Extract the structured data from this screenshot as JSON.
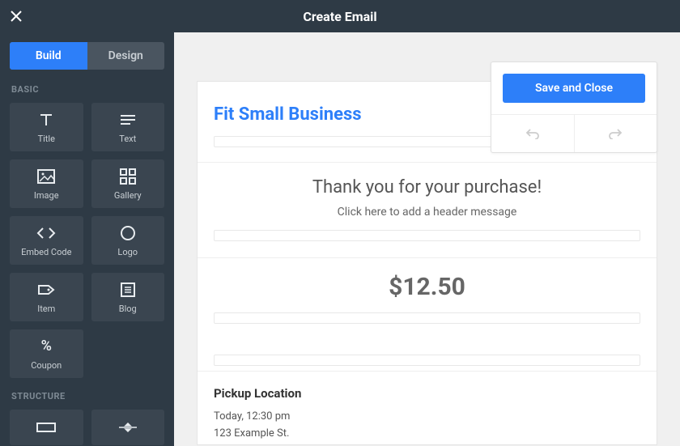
{
  "header": {
    "title": "Create Email"
  },
  "tabs": {
    "build": "Build",
    "design": "Design"
  },
  "sections": {
    "basic": "BASIC",
    "structure": "STRUCTURE"
  },
  "tiles": {
    "title": "Title",
    "text": "Text",
    "image": "Image",
    "gallery": "Gallery",
    "embed": "Embed Code",
    "logo": "Logo",
    "item": "Item",
    "blog": "Blog",
    "coupon": "Coupon"
  },
  "floater": {
    "save": "Save and Close"
  },
  "email": {
    "brand": "Fit Small Business",
    "thanks": "Thank you for your purchase!",
    "subhead": "Click here to add a header message",
    "amount": "$12.50",
    "pickup_title": "Pickup Location",
    "pickup_time": "Today, 12:30 pm",
    "pickup_addr": "123 Example St."
  }
}
